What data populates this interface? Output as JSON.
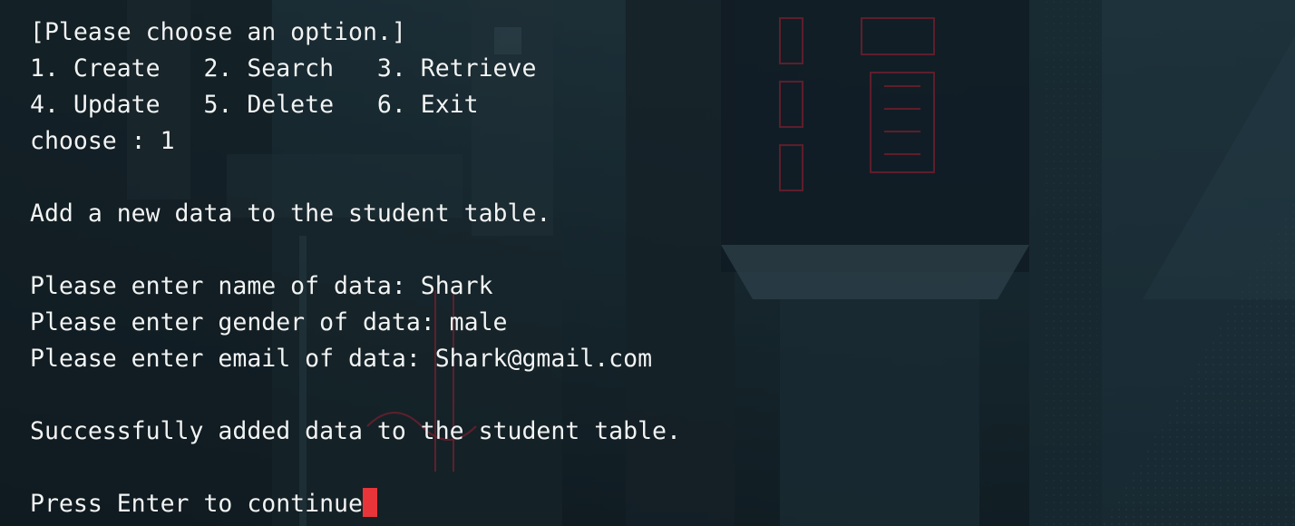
{
  "terminal": {
    "lines": [
      "[Please choose an option.]",
      "1. Create   2. Search   3. Retrieve",
      "4. Update   5. Delete   6. Exit",
      "choose : 1",
      "",
      "Add a new data to the student table.",
      "",
      "Please enter name of data: Shark",
      "Please enter gender of data: male",
      "Please enter email of data: Shark@gmail.com",
      "",
      "Successfully added data to the student table.",
      "",
      "Press Enter to continue"
    ],
    "cursor_color": "#e8353a",
    "text_color": "#f2f4f4"
  }
}
